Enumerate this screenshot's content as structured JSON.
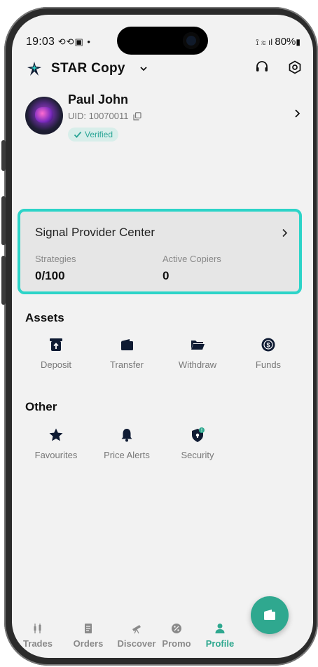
{
  "colors": {
    "accent": "#2fa88f",
    "highlight_border": "#2dd4c8",
    "verified_text": "#2aa596",
    "icon_dark": "#0f1b33"
  },
  "status_bar": {
    "time": "19:03",
    "battery": "80%"
  },
  "header": {
    "app_title": "STAR Copy"
  },
  "profile": {
    "name": "Paul John",
    "uid": "UID: 10070011",
    "verified": "Verified"
  },
  "signal_provider": {
    "title": "Signal Provider Center",
    "strategies_label": "Strategies",
    "strategies_value": "0/100",
    "copiers_label": "Active Copiers",
    "copiers_value": "0"
  },
  "assets": {
    "title": "Assets",
    "items": [
      {
        "label": "Deposit",
        "icon": "deposit-icon"
      },
      {
        "label": "Transfer",
        "icon": "wallet-icon"
      },
      {
        "label": "Withdraw",
        "icon": "folder-icon"
      },
      {
        "label": "Funds",
        "icon": "coin-icon"
      }
    ]
  },
  "other": {
    "title": "Other",
    "items": [
      {
        "label": "Favourites",
        "icon": "star-icon"
      },
      {
        "label": "Price Alerts",
        "icon": "bell-icon"
      },
      {
        "label": "Security",
        "icon": "shield-icon"
      }
    ]
  },
  "bottom_nav": {
    "items": [
      {
        "label": "Trades",
        "icon": "candles-icon"
      },
      {
        "label": "Orders",
        "icon": "document-icon"
      },
      {
        "label": "Discover",
        "icon": "telescope-icon"
      },
      {
        "label": "Promo",
        "icon": "discount-icon"
      },
      {
        "label": "Profile",
        "icon": "user-icon",
        "active": true
      }
    ]
  }
}
